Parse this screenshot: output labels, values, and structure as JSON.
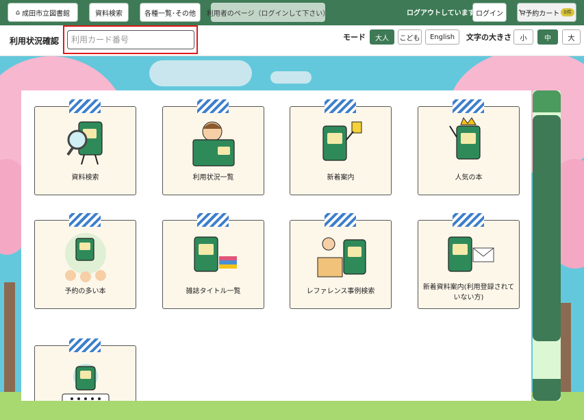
{
  "header": {
    "home_label": "成田市立図書館",
    "search_label": "資料検索",
    "lists_label": "各種一覧･その他",
    "user_page_label": "利用者のページ（ログインして下さい）",
    "logged_out_text": "ログアウトしています",
    "login_label": "ログイン",
    "cart_label": "予約カート",
    "cart_count": "0件"
  },
  "subbar": {
    "page_title": "利用状況確認",
    "card_placeholder": "利用カード番号",
    "mode_label": "モード",
    "mode_options": [
      "大人",
      "こども",
      "English"
    ],
    "mode_selected": "大人",
    "font_size_label": "文字の大きさ",
    "font_size_options": [
      "小",
      "中",
      "大"
    ],
    "font_size_selected": "中"
  },
  "menu": {
    "tiles": [
      {
        "label": "資料検索",
        "icon": "book-magnifier-icon"
      },
      {
        "label": "利用状況一覧",
        "icon": "boy-reading-book-icon"
      },
      {
        "label": "新着案内",
        "icon": "book-with-new-item-icon"
      },
      {
        "label": "人気の本",
        "icon": "book-with-crown-icon"
      },
      {
        "label": "予約の多い本",
        "icon": "book-with-children-icon"
      },
      {
        "label": "雑誌タイトル一覧",
        "icon": "book-with-magazines-icon"
      },
      {
        "label": "レファレンス事例検索",
        "icon": "librarian-desk-icon"
      },
      {
        "label": "新着資料案内(利用登録されていない方)",
        "icon": "book-with-envelope-icon"
      },
      {
        "label": "",
        "icon": "book-with-password-icon"
      }
    ]
  },
  "colors": {
    "brand_green": "#3d7a55",
    "highlight_red": "#e01818",
    "tape_blue": "#3d7fcc",
    "tile_cream": "#fdf7ea",
    "sky": "#63c8dc",
    "blossom": "#f7b7cf"
  }
}
